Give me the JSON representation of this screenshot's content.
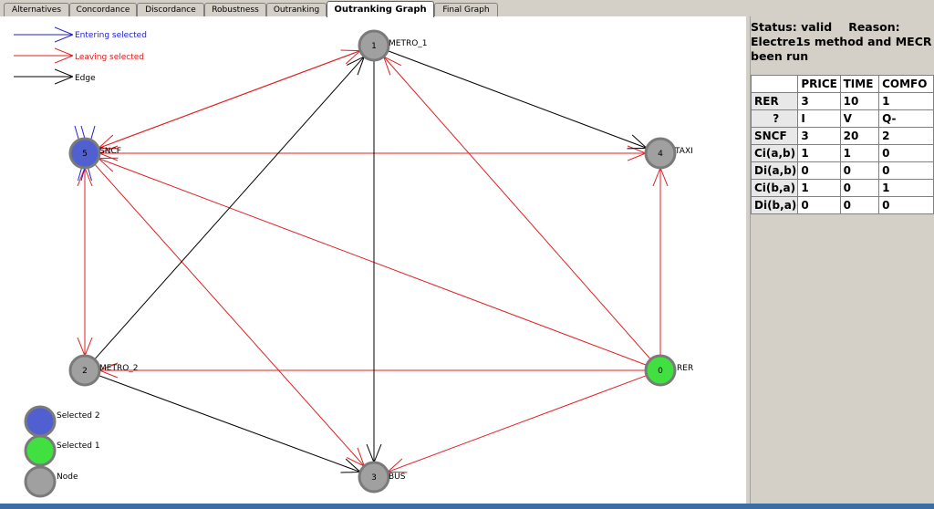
{
  "tabs": [
    {
      "label": "Alternatives"
    },
    {
      "label": "Concordance"
    },
    {
      "label": "Discordance"
    },
    {
      "label": "Robustness"
    },
    {
      "label": "Outranking"
    },
    {
      "label": "Outranking Graph",
      "active": true
    },
    {
      "label": "Final Graph"
    }
  ],
  "legend": {
    "entering": "Entering selected",
    "leaving": "Leaving selected",
    "edge": "Edge",
    "selected2": "Selected 2",
    "selected1": "Selected 1",
    "node": "Node"
  },
  "nodes": [
    {
      "id": "0",
      "name": "RER",
      "state": "selected1"
    },
    {
      "id": "1",
      "name": "METRO_1",
      "state": "node"
    },
    {
      "id": "2",
      "name": "METRO_2",
      "state": "node"
    },
    {
      "id": "3",
      "name": "BUS",
      "state": "node"
    },
    {
      "id": "4",
      "name": "TAXI",
      "state": "node"
    },
    {
      "id": "5",
      "name": "SNCF",
      "state": "selected2"
    }
  ],
  "colors": {
    "entering": "#2020d0",
    "leaving": "#e02020",
    "edge": "#000000",
    "selected1": "#40e040",
    "selected2": "#5060d0",
    "node": "#a0a0a0"
  },
  "status": {
    "status_line": "Status: valid",
    "reason_label": "Reason:",
    "message_line1": "Electre1s method and MECR ha",
    "message_line2": "been run"
  },
  "table": {
    "headers": [
      "",
      "PRICE",
      "TIME",
      "COMFO"
    ],
    "rows": [
      [
        "RER",
        "3",
        "10",
        "1"
      ],
      [
        "?",
        "I",
        "V",
        "Q-"
      ],
      [
        "SNCF",
        "3",
        "20",
        "2"
      ],
      [
        "Ci(a,b)",
        "1",
        "1",
        "0"
      ],
      [
        "Di(a,b)",
        "0",
        "0",
        "0"
      ],
      [
        "Ci(b,a)",
        "1",
        "0",
        "1"
      ],
      [
        "Di(b,a)",
        "0",
        "0",
        "0"
      ]
    ]
  }
}
